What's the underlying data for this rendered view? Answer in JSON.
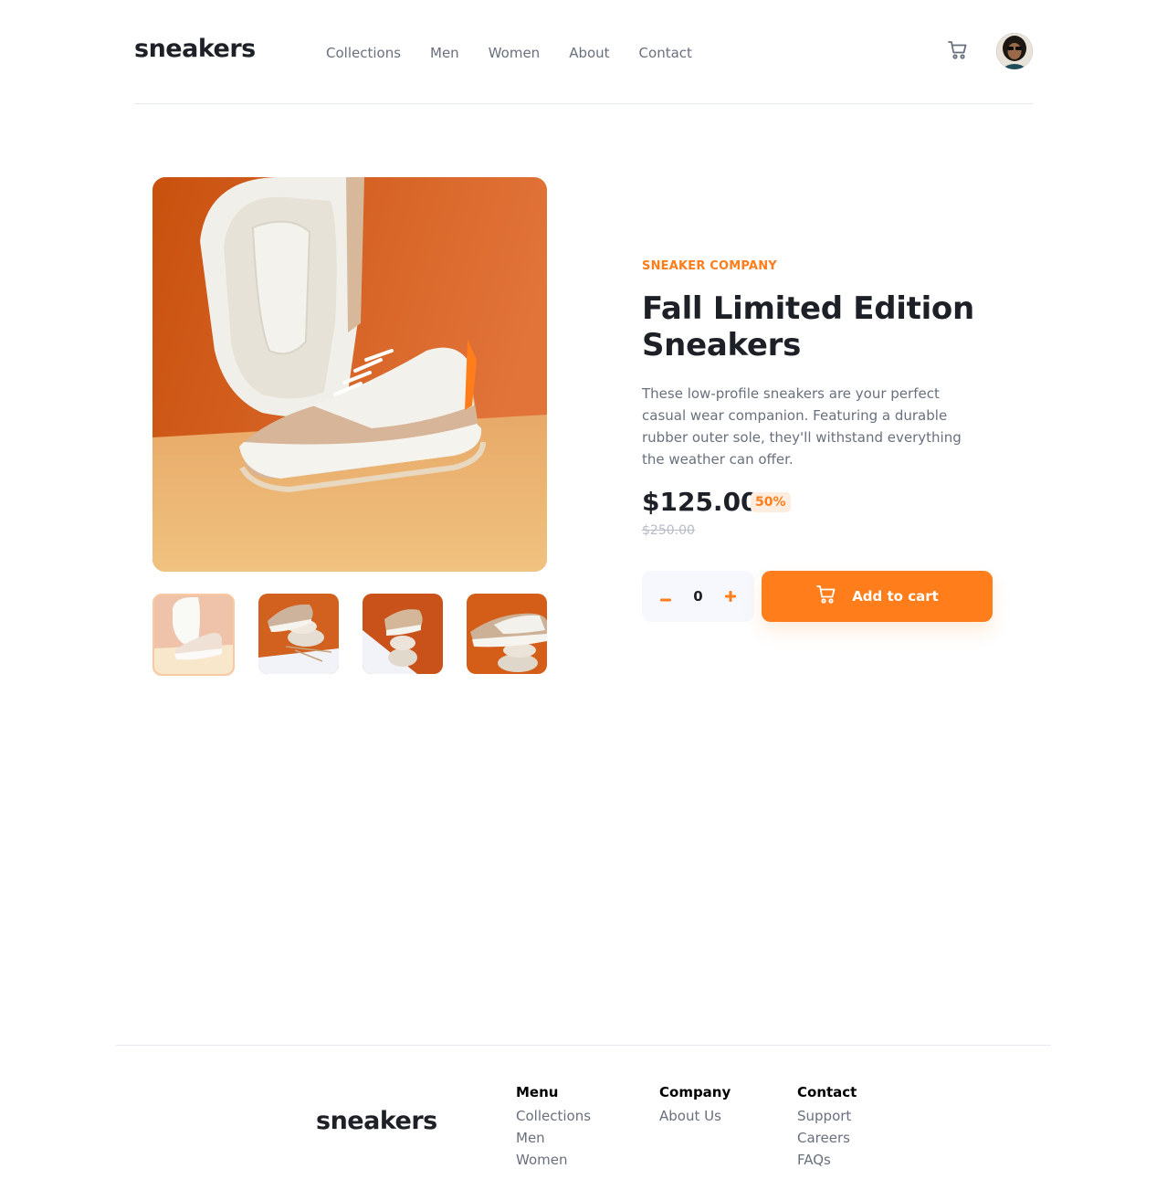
{
  "header": {
    "logo": "sneakers",
    "nav": [
      "Collections",
      "Men",
      "Women",
      "About",
      "Contact"
    ]
  },
  "product": {
    "company": "SNEAKER COMPANY",
    "title": "Fall Limited Edition Sneakers",
    "description": "These low-profile sneakers are your perfect casual wear companion. Featuring a durable rubber outer sole, they'll withstand everything the weather can offer.",
    "price": "$125.00",
    "discount": "50%",
    "old_price": "$250.00",
    "quantity": "0",
    "add_to_cart_label": "Add to cart"
  },
  "footer": {
    "logo": "sneakers",
    "columns": [
      {
        "heading": "Menu",
        "links": [
          "Collections",
          "Men",
          "Women"
        ]
      },
      {
        "heading": "Company",
        "links": [
          "About Us"
        ]
      },
      {
        "heading": "Contact",
        "links": [
          "Support",
          "Careers",
          "FAQs"
        ]
      }
    ]
  },
  "colors": {
    "accent": "#ff7e1b",
    "accent_light": "#ffede0",
    "text_dark": "#1d2026",
    "text_muted": "#69707d",
    "text_light": "#b6bcc8"
  }
}
